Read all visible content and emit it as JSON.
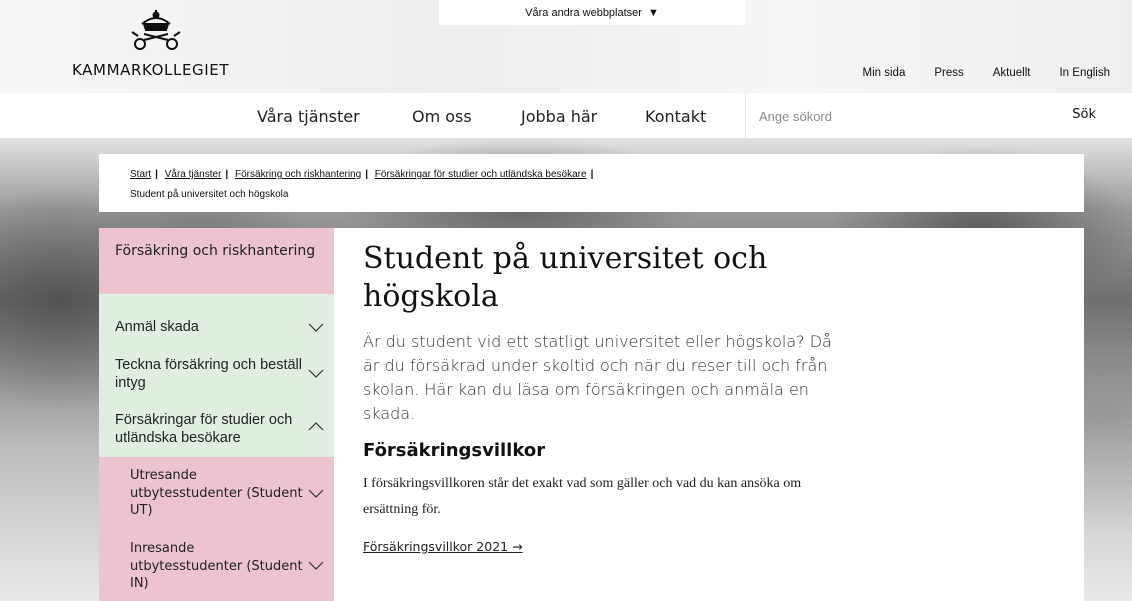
{
  "header": {
    "logo_text": "KAMMARKOLLEGIET",
    "other_sites_label": "Våra andra webbplatser",
    "utility_links": [
      "Min sida",
      "Press",
      "Aktuellt",
      "In English"
    ]
  },
  "main_nav": {
    "items": [
      "Våra tjänster",
      "Om oss",
      "Jobba här",
      "Kontakt"
    ],
    "search_placeholder": "Ange sökord",
    "search_button": "Sök"
  },
  "breadcrumb": {
    "items": [
      "Start",
      "Våra tjänster",
      "Försäkring och riskhantering",
      "Försäkringar för studier och utländska besökare"
    ],
    "current": "Student på universitet och högskola"
  },
  "sidebar": {
    "heading": "Försäkring och riskhantering",
    "items": [
      {
        "label": "Anmäl skada",
        "expanded": false
      },
      {
        "label": "Teckna försäkring och beställ intyg",
        "expanded": false
      },
      {
        "label": "Försäkringar för studier och utländska besökare",
        "expanded": true
      }
    ],
    "sub_items": [
      {
        "label": "Utresande utbytesstudenter (Student UT)"
      },
      {
        "label": "Inresande utbytesstudenter (Student IN)"
      }
    ],
    "colors": {
      "pink": "#ecc3ce",
      "green": "#dfeee0"
    }
  },
  "article": {
    "title": "Student på universitet och högskola",
    "lead": "Är du student vid ett statligt universitet eller högskola? Då är du försäkrad under skoltid och när du reser till och från skolan. Här kan du läsa om försäkringen och anmäla en skada.",
    "section_heading": "Försäkringsvillkor",
    "section_text": "I försäkringsvillkoren står det exakt vad som gäller och vad du kan ansöka om ersättning för.",
    "link_label": "Försäkringsvillkor 2021 →"
  }
}
